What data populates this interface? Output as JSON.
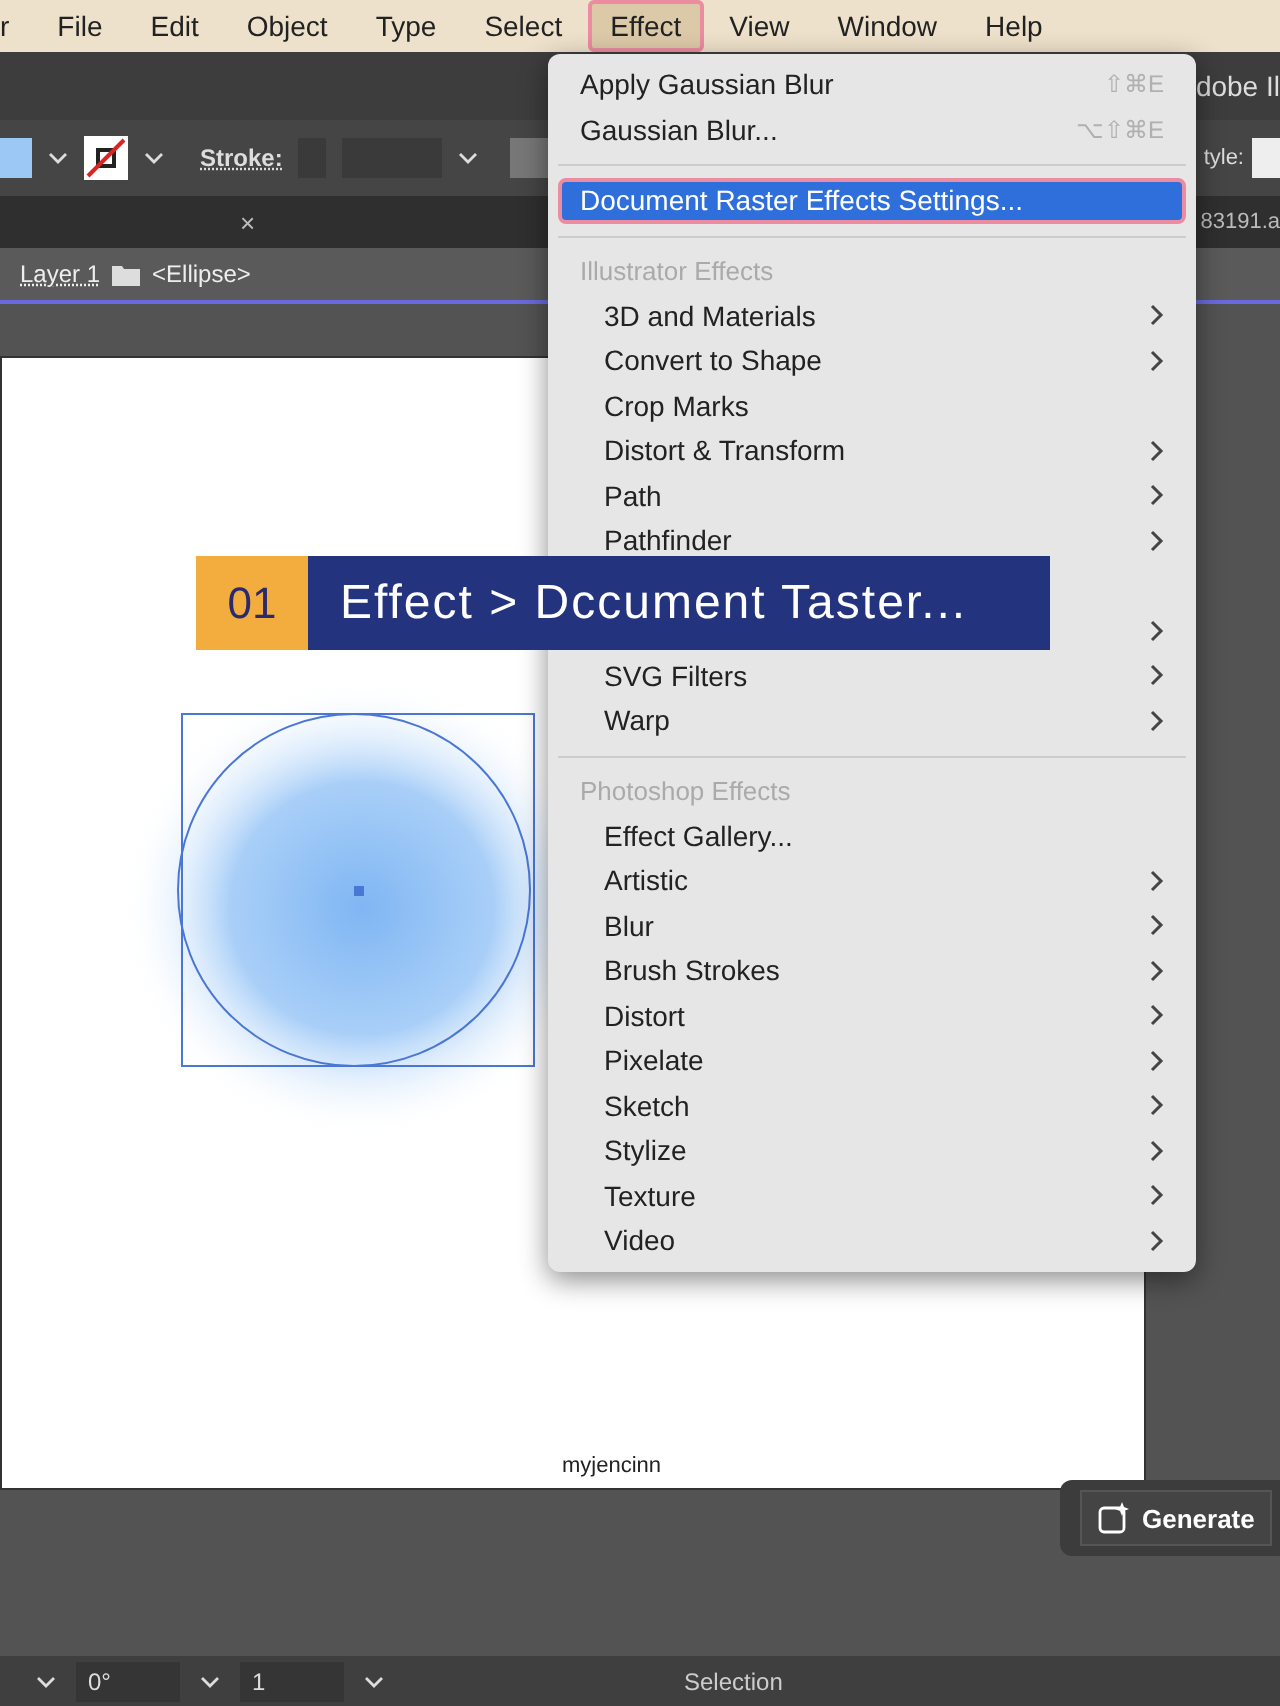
{
  "menu_bar": {
    "items": [
      {
        "label": "r",
        "selected": false
      },
      {
        "label": "File",
        "selected": false
      },
      {
        "label": "Edit",
        "selected": false
      },
      {
        "label": "Object",
        "selected": false
      },
      {
        "label": "Type",
        "selected": false
      },
      {
        "label": "Select",
        "selected": false
      },
      {
        "label": "Effect",
        "selected": true
      },
      {
        "label": "View",
        "selected": false
      },
      {
        "label": "Window",
        "selected": false
      },
      {
        "label": "Help",
        "selected": false
      }
    ]
  },
  "title_bar": {
    "title": "dobe Il"
  },
  "control_bar": {
    "stroke_label": "Stroke:",
    "style_label": "tyle:"
  },
  "tabs": {
    "close": "×",
    "right_tab": "83191.a"
  },
  "breadcrumb": {
    "layer": "Layer 1",
    "object": "<Ellipse>"
  },
  "effect_menu": {
    "sections": [
      {
        "items": [
          {
            "kind": "item",
            "label": "Apply Gaussian Blur",
            "shortcut": "⇧⌘E",
            "submenu": false,
            "selected": false
          },
          {
            "kind": "item",
            "label": "Gaussian Blur...",
            "shortcut": "⌥⇧⌘E",
            "submenu": false,
            "selected": false
          }
        ]
      },
      {
        "items": [
          {
            "kind": "item",
            "label": "Document Raster Effects Settings...",
            "submenu": false,
            "selected": true
          }
        ]
      },
      {
        "items": [
          {
            "kind": "header",
            "label": "Illustrator Effects"
          },
          {
            "kind": "item",
            "label": "3D and Materials",
            "submenu": true,
            "selected": false
          },
          {
            "kind": "item",
            "label": "Convert to Shape",
            "submenu": true,
            "selected": false
          },
          {
            "kind": "item",
            "label": "Crop Marks",
            "submenu": false,
            "selected": false
          },
          {
            "kind": "item",
            "label": "Distort & Transform",
            "submenu": true,
            "selected": false
          },
          {
            "kind": "item",
            "label": "Path",
            "submenu": true,
            "selected": false
          },
          {
            "kind": "item",
            "label": "Pathfinder",
            "submenu": true,
            "selected": false
          },
          {
            "kind": "covered"
          },
          {
            "kind": "covered",
            "submenu": true
          },
          {
            "kind": "item",
            "label": "SVG Filters",
            "submenu": true,
            "selected": false
          },
          {
            "kind": "item",
            "label": "Warp",
            "submenu": true,
            "selected": false
          }
        ]
      },
      {
        "items": [
          {
            "kind": "header",
            "label": "Photoshop Effects"
          },
          {
            "kind": "item",
            "label": "Effect Gallery...",
            "submenu": false,
            "selected": false
          },
          {
            "kind": "item",
            "label": "Artistic",
            "submenu": true,
            "selected": false
          },
          {
            "kind": "item",
            "label": "Blur",
            "submenu": true,
            "selected": false
          },
          {
            "kind": "item",
            "label": "Brush Strokes",
            "submenu": true,
            "selected": false
          },
          {
            "kind": "item",
            "label": "Distort",
            "submenu": true,
            "selected": false
          },
          {
            "kind": "item",
            "label": "Pixelate",
            "submenu": true,
            "selected": false
          },
          {
            "kind": "item",
            "label": "Sketch",
            "submenu": true,
            "selected": false
          },
          {
            "kind": "item",
            "label": "Stylize",
            "submenu": true,
            "selected": false
          },
          {
            "kind": "item",
            "label": "Texture",
            "submenu": true,
            "selected": false
          },
          {
            "kind": "item",
            "label": "Video",
            "submenu": true,
            "selected": false
          }
        ]
      }
    ]
  },
  "step_banner": {
    "number": "01",
    "text": "Effect > Dccument Taster..."
  },
  "artboard": {
    "caption": "myjencinn"
  },
  "generate_panel": {
    "button": "Generate"
  },
  "status_bar": {
    "rotation": "0°",
    "artboard_number": "1",
    "tool": "Selection"
  }
}
